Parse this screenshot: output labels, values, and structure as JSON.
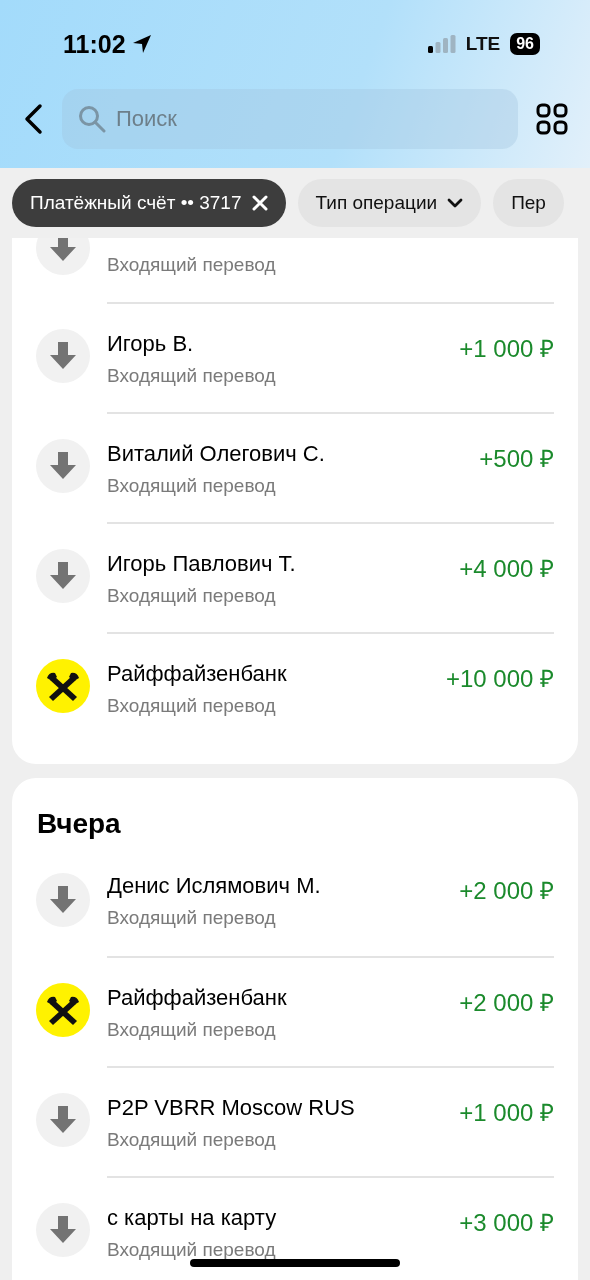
{
  "status_bar": {
    "time": "11:02",
    "network": "LTE",
    "battery": "96"
  },
  "search": {
    "placeholder": "Поиск"
  },
  "filters": [
    {
      "label": "Платёжный счёт •• 3717",
      "selected": true,
      "dropdown": false
    },
    {
      "label": "Тип операции",
      "selected": false,
      "dropdown": true
    },
    {
      "label": "Пер",
      "selected": false,
      "dropdown": false
    }
  ],
  "sections": [
    {
      "transactions": [
        {
          "kind": "partial",
          "subtitle": "Входящий перевод"
        },
        {
          "kind": "person",
          "name": "Игорь В.",
          "subtitle": "Входящий перевод",
          "amount": "+1 000 ₽"
        },
        {
          "kind": "person",
          "name": "Виталий Олегович С.",
          "subtitle": "Входящий перевод",
          "amount": "+500 ₽"
        },
        {
          "kind": "person",
          "name": "Игорь Павлович Т.",
          "subtitle": "Входящий перевод",
          "amount": "+4 000 ₽"
        },
        {
          "kind": "bank",
          "name": "Райффайзенбанк",
          "subtitle": "Входящий перевод",
          "amount": "+10 000 ₽"
        }
      ]
    },
    {
      "title": "Вчера",
      "transactions": [
        {
          "kind": "person",
          "name": "Денис Ислямович М.",
          "subtitle": "Входящий перевод",
          "amount": "+2 000 ₽"
        },
        {
          "kind": "bank",
          "name": "Райффайзенбанк",
          "subtitle": "Входящий перевод",
          "amount": "+2 000 ₽"
        },
        {
          "kind": "person",
          "name": "P2P VBRR Moscow RUS",
          "subtitle": "Входящий перевод",
          "amount": "+1 000 ₽"
        },
        {
          "kind": "person",
          "name": "с карты на карту",
          "subtitle": "Входящий перевод",
          "amount": "+3 000 ₽"
        }
      ]
    }
  ]
}
